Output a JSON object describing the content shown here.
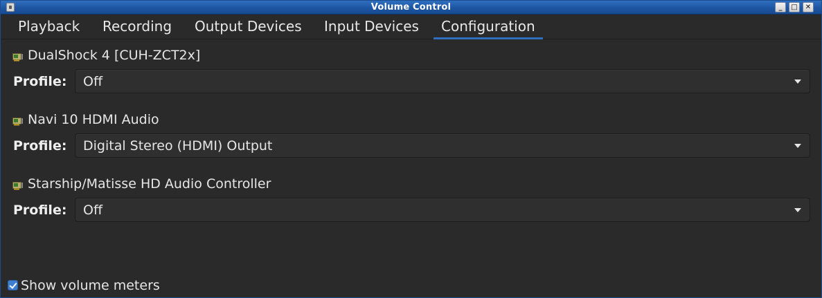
{
  "window": {
    "title": "Volume Control",
    "buttons": {
      "minimize": "_",
      "maximize": "□",
      "close": "✕"
    }
  },
  "tabs": [
    {
      "label": "Playback",
      "active": false
    },
    {
      "label": "Recording",
      "active": false
    },
    {
      "label": "Output Devices",
      "active": false
    },
    {
      "label": "Input Devices",
      "active": false
    },
    {
      "label": "Configuration",
      "active": true
    }
  ],
  "devices": [
    {
      "icon": "sound-card-icon",
      "name": "DualShock 4 [CUH-ZCT2x]",
      "profile_label": "Profile:",
      "profile": "Off"
    },
    {
      "icon": "sound-card-icon",
      "name": "Navi 10 HDMI Audio",
      "profile_label": "Profile:",
      "profile": "Digital Stereo (HDMI) Output"
    },
    {
      "icon": "sound-card-icon",
      "name": "Starship/Matisse HD Audio Controller",
      "profile_label": "Profile:",
      "profile": "Off"
    }
  ],
  "footer": {
    "show_meters_label": "Show volume meters",
    "show_meters_checked": true
  },
  "colors": {
    "accent": "#2f6fc0",
    "titlebar": "#1e56a3",
    "background": "#2a2a2a"
  }
}
